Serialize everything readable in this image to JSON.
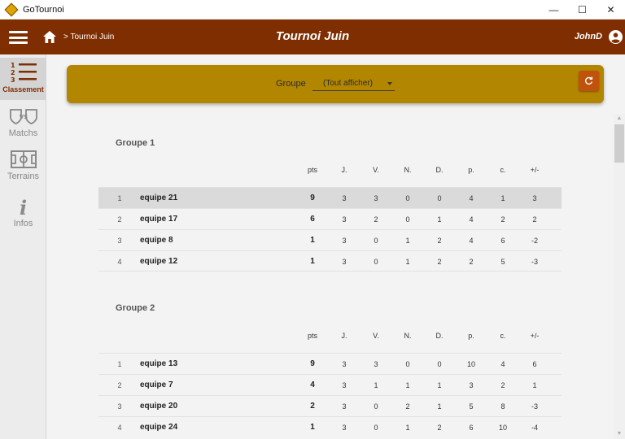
{
  "window": {
    "title": "GoTournoi",
    "minimize": "—",
    "maximize": "☐",
    "close": "✕"
  },
  "header": {
    "breadcrumb": "> Tournoi Juin",
    "title": "Tournoi Juin",
    "user": "JohnD"
  },
  "nav": {
    "classement": "Classement",
    "matchs": "Matchs",
    "terrains": "Terrains",
    "infos": "Infos",
    "infos_glyph": "i"
  },
  "filter": {
    "label": "Groupe",
    "value": "(Tout afficher)"
  },
  "columns": {
    "pts": "pts",
    "j": "J.",
    "v": "V.",
    "n": "N.",
    "d": "D.",
    "p": "p.",
    "c": "c.",
    "diff": "+/-"
  },
  "groups": [
    {
      "title": "Groupe 1",
      "rows": [
        {
          "rank": "1",
          "team": "equipe 21",
          "pts": "9",
          "j": "3",
          "v": "3",
          "n": "0",
          "d": "0",
          "p": "4",
          "c": "1",
          "diff": "3"
        },
        {
          "rank": "2",
          "team": "equipe 17",
          "pts": "6",
          "j": "3",
          "v": "2",
          "n": "0",
          "d": "1",
          "p": "4",
          "c": "2",
          "diff": "2"
        },
        {
          "rank": "3",
          "team": "equipe 8",
          "pts": "1",
          "j": "3",
          "v": "0",
          "n": "1",
          "d": "2",
          "p": "4",
          "c": "6",
          "diff": "-2"
        },
        {
          "rank": "4",
          "team": "equipe 12",
          "pts": "1",
          "j": "3",
          "v": "0",
          "n": "1",
          "d": "2",
          "p": "2",
          "c": "5",
          "diff": "-3"
        }
      ]
    },
    {
      "title": "Groupe 2",
      "rows": [
        {
          "rank": "1",
          "team": "equipe 13",
          "pts": "9",
          "j": "3",
          "v": "3",
          "n": "0",
          "d": "0",
          "p": "10",
          "c": "4",
          "diff": "6"
        },
        {
          "rank": "2",
          "team": "equipe 7",
          "pts": "4",
          "j": "3",
          "v": "1",
          "n": "1",
          "d": "1",
          "p": "3",
          "c": "2",
          "diff": "1"
        },
        {
          "rank": "3",
          "team": "equipe 20",
          "pts": "2",
          "j": "3",
          "v": "0",
          "n": "2",
          "d": "1",
          "p": "5",
          "c": "8",
          "diff": "-3"
        },
        {
          "rank": "4",
          "team": "equipe 24",
          "pts": "1",
          "j": "3",
          "v": "0",
          "n": "1",
          "d": "2",
          "p": "6",
          "c": "10",
          "diff": "-4"
        }
      ]
    }
  ],
  "colors": {
    "header": "#7e2e00",
    "filter_card": "#b38600",
    "refresh_button": "#c0520b",
    "active_nav": "#7e2e00"
  },
  "icons": {
    "menu": "hamburger-icon",
    "home": "home-icon",
    "user": "user-circle-icon",
    "refresh": "refresh-icon",
    "classement": "ranking-list-icon",
    "matchs": "versus-shields-icon",
    "terrains": "soccer-field-icon",
    "infos": "info-icon",
    "dropdown": "chevron-down-icon"
  }
}
